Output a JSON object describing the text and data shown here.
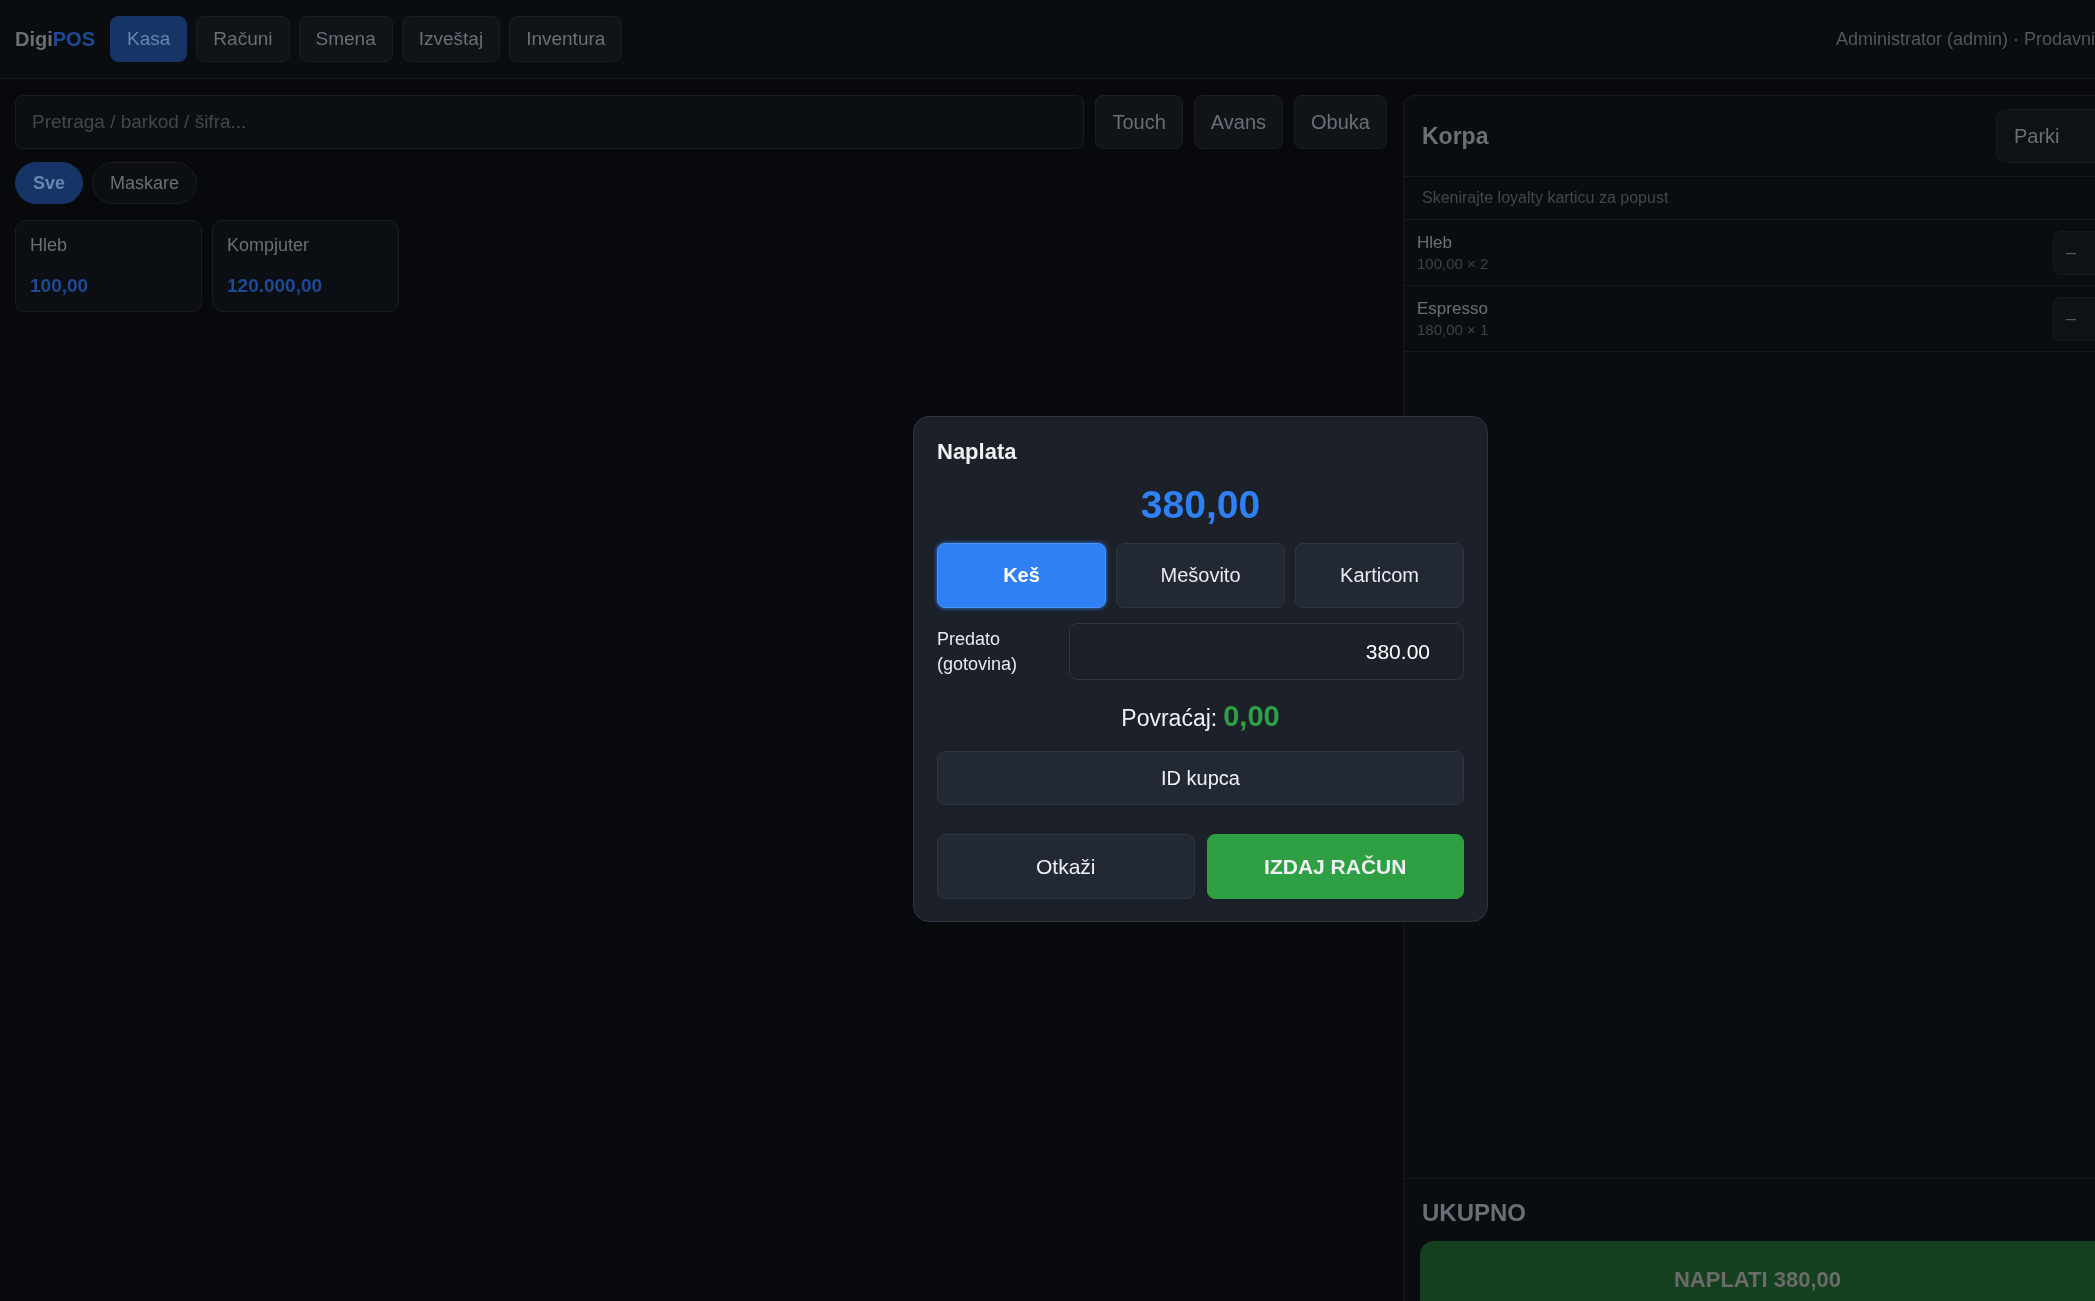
{
  "topbar": {
    "logo": {
      "part_1": "Digi",
      "part_2": "POS"
    },
    "nav_tabs": [
      {
        "label": "Kasa",
        "selected": true
      },
      {
        "label": "Računi",
        "selected": false
      },
      {
        "label": "Smena",
        "selected": false
      },
      {
        "label": "Izveštaj",
        "selected": false
      },
      {
        "label": "Inventura",
        "selected": false
      }
    ],
    "user": "Administrator (admin) · Prodavni"
  },
  "search": {
    "placeholder": "Pretraga / barkod / šifra..."
  },
  "toolbar_buttons": [
    "Touch",
    "Avans",
    "Obuka"
  ],
  "categories": [
    {
      "label": "Sve",
      "selected": true
    },
    {
      "label": "Maskare",
      "selected": false
    }
  ],
  "products": [
    {
      "name": "Hleb",
      "price": "100,00"
    },
    {
      "name": "Kompjuter",
      "price": "120.000,00"
    }
  ],
  "cart": {
    "title": "Korpa",
    "parking_button": "Parki",
    "loyalty_hint": "Skenirajte loyalty karticu za popust",
    "items": [
      {
        "name": "Hleb",
        "detail": "100,00 × 2",
        "minus": "–"
      },
      {
        "name": "Espresso",
        "detail": "180,00 × 1",
        "minus": "–"
      }
    ],
    "total_label": "UKUPNO",
    "pay_button": "NAPLATI 380,00"
  },
  "payment_dialog": {
    "title": "Naplata",
    "amount": "380,00",
    "methods": [
      {
        "label": "Keš",
        "selected": true
      },
      {
        "label": "Mešovito",
        "selected": false
      },
      {
        "label": "Karticom",
        "selected": false
      }
    ],
    "tendered_label": "Predato (gotovina)",
    "tendered_value": "380.00",
    "change_label": "Povraćaj:",
    "change_value": "0,00",
    "customer_id_button": "ID kupca",
    "cancel_button": "Otkaži",
    "confirm_button": "IZDAJ RAČUN"
  }
}
